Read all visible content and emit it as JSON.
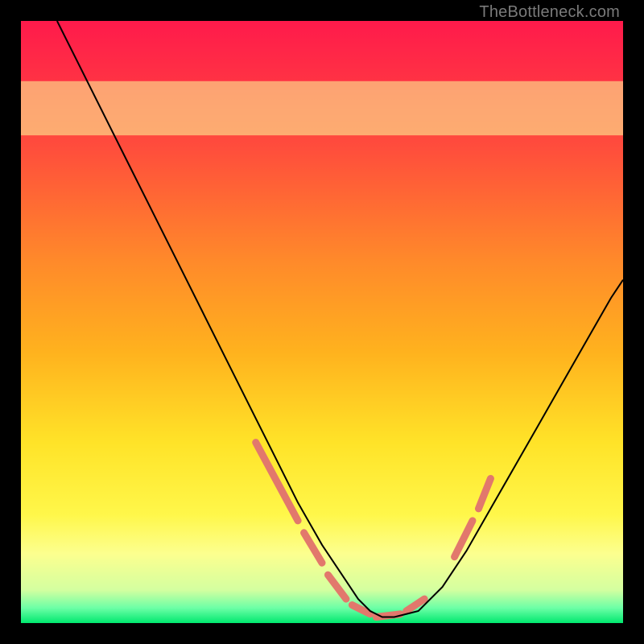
{
  "watermark": "TheBottleneck.com",
  "chart_data": {
    "type": "line",
    "title": "",
    "xlabel": "",
    "ylabel": "",
    "xlim": [
      0,
      100
    ],
    "ylim": [
      0,
      100
    ],
    "background_gradient": {
      "stops": [
        {
          "offset": 0.0,
          "color": "#ff1a4b"
        },
        {
          "offset": 0.2,
          "color": "#ff4a3d"
        },
        {
          "offset": 0.4,
          "color": "#ff8a2a"
        },
        {
          "offset": 0.55,
          "color": "#ffb21e"
        },
        {
          "offset": 0.7,
          "color": "#ffe328"
        },
        {
          "offset": 0.82,
          "color": "#fff74a"
        },
        {
          "offset": 0.885,
          "color": "#fcff8f"
        },
        {
          "offset": 0.945,
          "color": "#d4ffa0"
        },
        {
          "offset": 0.975,
          "color": "#6cffa6"
        },
        {
          "offset": 1.0,
          "color": "#00e86e"
        }
      ]
    },
    "pale_band": {
      "y0": 81,
      "y1": 90,
      "color": "#fcff9a"
    },
    "series": [
      {
        "name": "curve",
        "x": [
          6,
          10,
          14,
          18,
          22,
          26,
          30,
          34,
          38,
          42,
          46,
          50,
          54,
          56,
          58,
          60,
          62,
          66,
          70,
          74,
          78,
          82,
          86,
          90,
          94,
          98,
          100
        ],
        "y": [
          100,
          92,
          84,
          76,
          68,
          60,
          52,
          44,
          36,
          28,
          20,
          13,
          7,
          4,
          2,
          1,
          1,
          2,
          6,
          12,
          19,
          26,
          33,
          40,
          47,
          54,
          57
        ],
        "stroke": "#000000",
        "stroke_width": 2
      }
    ],
    "dash_segments": [
      {
        "x0": 39,
        "y0": 30,
        "x1": 46,
        "y1": 17
      },
      {
        "x0": 47,
        "y0": 15,
        "x1": 50,
        "y1": 10
      },
      {
        "x0": 51,
        "y0": 8,
        "x1": 54,
        "y1": 4
      },
      {
        "x0": 55,
        "y0": 3,
        "x1": 58,
        "y1": 1.5
      },
      {
        "x0": 59,
        "y0": 1,
        "x1": 63,
        "y1": 1.5
      },
      {
        "x0": 64,
        "y0": 2,
        "x1": 67,
        "y1": 4
      },
      {
        "x0": 72,
        "y0": 11,
        "x1": 75,
        "y1": 17
      },
      {
        "x0": 76,
        "y0": 19,
        "x1": 78,
        "y1": 24
      }
    ],
    "dash_style": {
      "stroke": "#e2786c",
      "stroke_width": 9,
      "linecap": "round"
    }
  }
}
